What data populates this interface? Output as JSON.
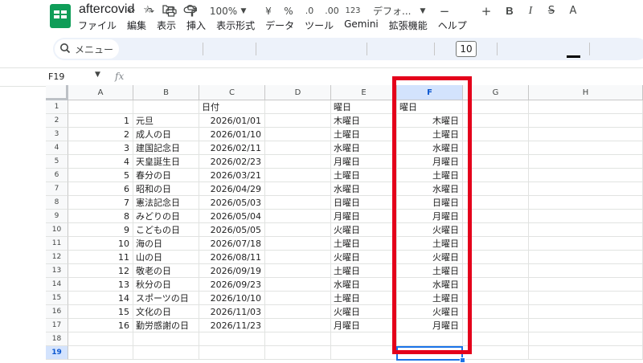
{
  "app": {
    "title": "aftercovid"
  },
  "menu": [
    "ファイル",
    "編集",
    "表示",
    "挿入",
    "表示形式",
    "データ",
    "ツール",
    "Gemini",
    "拡張機能",
    "ヘルプ"
  ],
  "toolbar": {
    "search_label": "メニュー",
    "zoom": "100%",
    "currency": "¥",
    "percent": "%",
    "decimal_decrease": ".0",
    "decimal_increase": ".00",
    "number_format": "123",
    "font": "デフォ...",
    "font_size": "10"
  },
  "formula_bar": {
    "name_box": "F19",
    "fx": "fx"
  },
  "columns": [
    "A",
    "B",
    "C",
    "D",
    "E",
    "F",
    "G",
    "H"
  ],
  "header_row": {
    "C": "日付",
    "E": "曜日",
    "F": "曜日"
  },
  "rows": [
    {
      "n": "1",
      "name": "元旦",
      "date": "2026/01/01",
      "e": "木曜日",
      "f": "木曜日"
    },
    {
      "n": "2",
      "name": "成人の日",
      "date": "2026/01/10",
      "e": "土曜日",
      "f": "土曜日"
    },
    {
      "n": "3",
      "name": "建国記念日",
      "date": "2026/02/11",
      "e": "水曜日",
      "f": "水曜日"
    },
    {
      "n": "4",
      "name": "天皇誕生日",
      "date": "2026/02/23",
      "e": "月曜日",
      "f": "月曜日"
    },
    {
      "n": "5",
      "name": "春分の日",
      "date": "2026/03/21",
      "e": "土曜日",
      "f": "土曜日"
    },
    {
      "n": "6",
      "name": "昭和の日",
      "date": "2026/04/29",
      "e": "水曜日",
      "f": "水曜日"
    },
    {
      "n": "7",
      "name": "憲法記念日",
      "date": "2026/05/03",
      "e": "日曜日",
      "f": "日曜日"
    },
    {
      "n": "8",
      "name": "みどりの日",
      "date": "2026/05/04",
      "e": "月曜日",
      "f": "月曜日"
    },
    {
      "n": "9",
      "name": "こどもの日",
      "date": "2026/05/05",
      "e": "火曜日",
      "f": "火曜日"
    },
    {
      "n": "10",
      "name": "海の日",
      "date": "2026/07/18",
      "e": "土曜日",
      "f": "土曜日"
    },
    {
      "n": "11",
      "name": "山の日",
      "date": "2026/08/11",
      "e": "火曜日",
      "f": "火曜日"
    },
    {
      "n": "12",
      "name": "敬老の日",
      "date": "2026/09/19",
      "e": "土曜日",
      "f": "土曜日"
    },
    {
      "n": "13",
      "name": "秋分の日",
      "date": "2026/09/23",
      "e": "水曜日",
      "f": "水曜日"
    },
    {
      "n": "14",
      "name": "スポーツの日",
      "date": "2026/10/10",
      "e": "土曜日",
      "f": "土曜日"
    },
    {
      "n": "15",
      "name": "文化の日",
      "date": "2026/11/03",
      "e": "火曜日",
      "f": "火曜日"
    },
    {
      "n": "16",
      "name": "勤労感謝の日",
      "date": "2026/11/23",
      "e": "月曜日",
      "f": "月曜日"
    }
  ],
  "row_numbers": [
    "1",
    "2",
    "3",
    "4",
    "5",
    "6",
    "7",
    "8",
    "9",
    "10",
    "11",
    "12",
    "13",
    "14",
    "15",
    "16",
    "17",
    "18",
    "19"
  ],
  "colors": {
    "accent": "#0f9d58",
    "selection": "#1a73e8",
    "highlight": "#e4001b",
    "header_selected": "#d3e3fd"
  }
}
